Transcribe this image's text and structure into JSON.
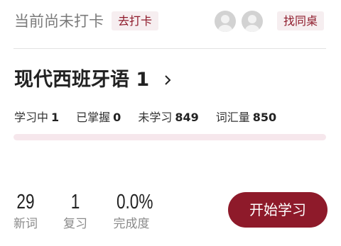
{
  "header": {
    "status_text": "当前尚未打卡",
    "checkin_label": "去打卡",
    "find_partner_label": "找同桌"
  },
  "course": {
    "title": "现代西班牙语 1"
  },
  "stats": {
    "learning_label": "学习中",
    "learning_value": "1",
    "mastered_label": "已掌握",
    "mastered_value": "0",
    "unlearned_label": "未学习",
    "unlearned_value": "849",
    "vocab_label": "词汇量",
    "vocab_value": "850"
  },
  "progress": {
    "fraction": 0.0
  },
  "metrics": {
    "new_value": "29",
    "new_label": "新词",
    "review_value": "1",
    "review_label": "复习",
    "completion_value": "0.0%",
    "completion_label": "完成度"
  },
  "actions": {
    "start_label": "开始学习"
  },
  "colors": {
    "accent": "#8e1a2a",
    "badge_bg": "#f6eef0",
    "track": "#f6e7ec"
  },
  "icons": {
    "avatar": "user-avatar-icon",
    "chevron": "chevron-right-icon"
  }
}
